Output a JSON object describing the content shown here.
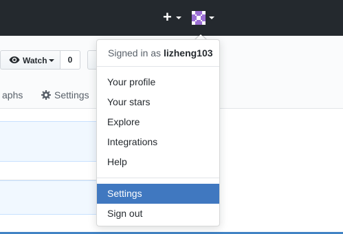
{
  "header": {
    "plus_icon": "+",
    "avatar_icon": "identicon-avatar",
    "avatar_color": "#9b6fd4"
  },
  "repo": {
    "watch_label": "Watch",
    "watch_count": "0",
    "tabs": {
      "graphs_label": "aphs",
      "settings_label": "Settings"
    }
  },
  "dropdown": {
    "signed_in_prefix": "Signed in as ",
    "username": "lizheng103",
    "items": [
      {
        "label": "Your profile"
      },
      {
        "label": "Your stars"
      },
      {
        "label": "Explore"
      },
      {
        "label": "Integrations"
      },
      {
        "label": "Help"
      }
    ],
    "settings_label": "Settings",
    "signout_label": "Sign out"
  },
  "colors": {
    "header_bg": "#24292e",
    "active_item_bg": "#4078c0",
    "accent_line": "#4183c4"
  }
}
